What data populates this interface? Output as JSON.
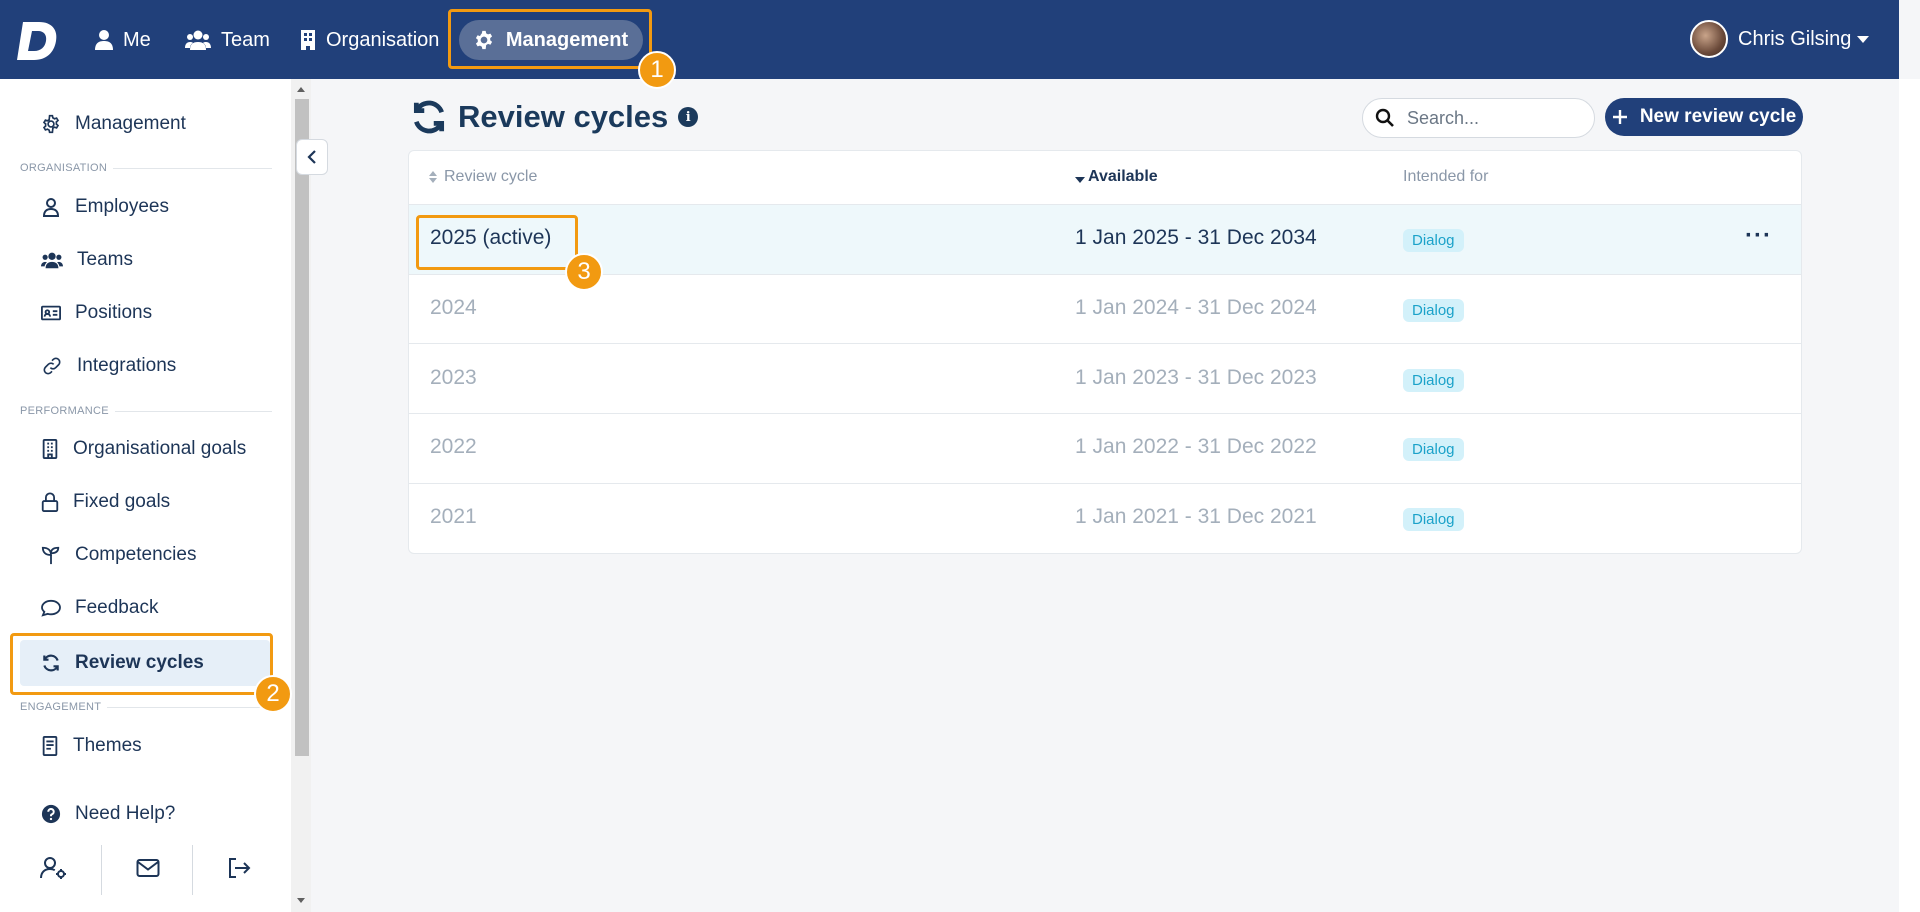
{
  "topnav": {
    "logo": "D",
    "items": [
      {
        "label": "Me",
        "icon": "user-icon"
      },
      {
        "label": "Team",
        "icon": "users-icon"
      },
      {
        "label": "Organisation",
        "icon": "building-icon"
      }
    ],
    "active": {
      "label": "Management",
      "icon": "gear-icon"
    },
    "user_name": "Chris Gilsing"
  },
  "sidebar": {
    "top_item": "Management",
    "sections": [
      {
        "title": "ORGANISATION",
        "items": [
          "Employees",
          "Teams",
          "Positions",
          "Integrations"
        ]
      },
      {
        "title": "PERFORMANCE",
        "items": [
          "Organisational goals",
          "Fixed goals",
          "Competencies",
          "Feedback",
          "Review cycles"
        ]
      },
      {
        "title": "ENGAGEMENT",
        "items": [
          "Themes"
        ]
      }
    ],
    "help": "Need Help?",
    "active_item": "Review cycles"
  },
  "page": {
    "title": "Review cycles",
    "info": "i",
    "search_placeholder": "Search...",
    "new_button": "New review cycle"
  },
  "table": {
    "columns": [
      "Review cycle",
      "Available",
      "Intended for"
    ],
    "rows": [
      {
        "cycle": "2025 (active)",
        "available": "1 Jan 2025 - 31 Dec 2034",
        "intended_for": "Dialog",
        "active": true,
        "menu": "···"
      },
      {
        "cycle": "2024",
        "available": "1 Jan 2024 - 31 Dec 2024",
        "intended_for": "Dialog",
        "active": false
      },
      {
        "cycle": "2023",
        "available": "1 Jan 2023 - 31 Dec 2023",
        "intended_for": "Dialog",
        "active": false
      },
      {
        "cycle": "2022",
        "available": "1 Jan 2022 - 31 Dec 2022",
        "intended_for": "Dialog",
        "active": false
      },
      {
        "cycle": "2021",
        "available": "1 Jan 2021 - 31 Dec 2021",
        "intended_for": "Dialog",
        "active": false
      }
    ]
  },
  "annotations": [
    "1",
    "2",
    "3"
  ],
  "colors": {
    "brand": "#21407a",
    "highlight": "#f29a11",
    "badge_bg": "#d3f1fa",
    "badge_text": "#1ba2c9"
  }
}
